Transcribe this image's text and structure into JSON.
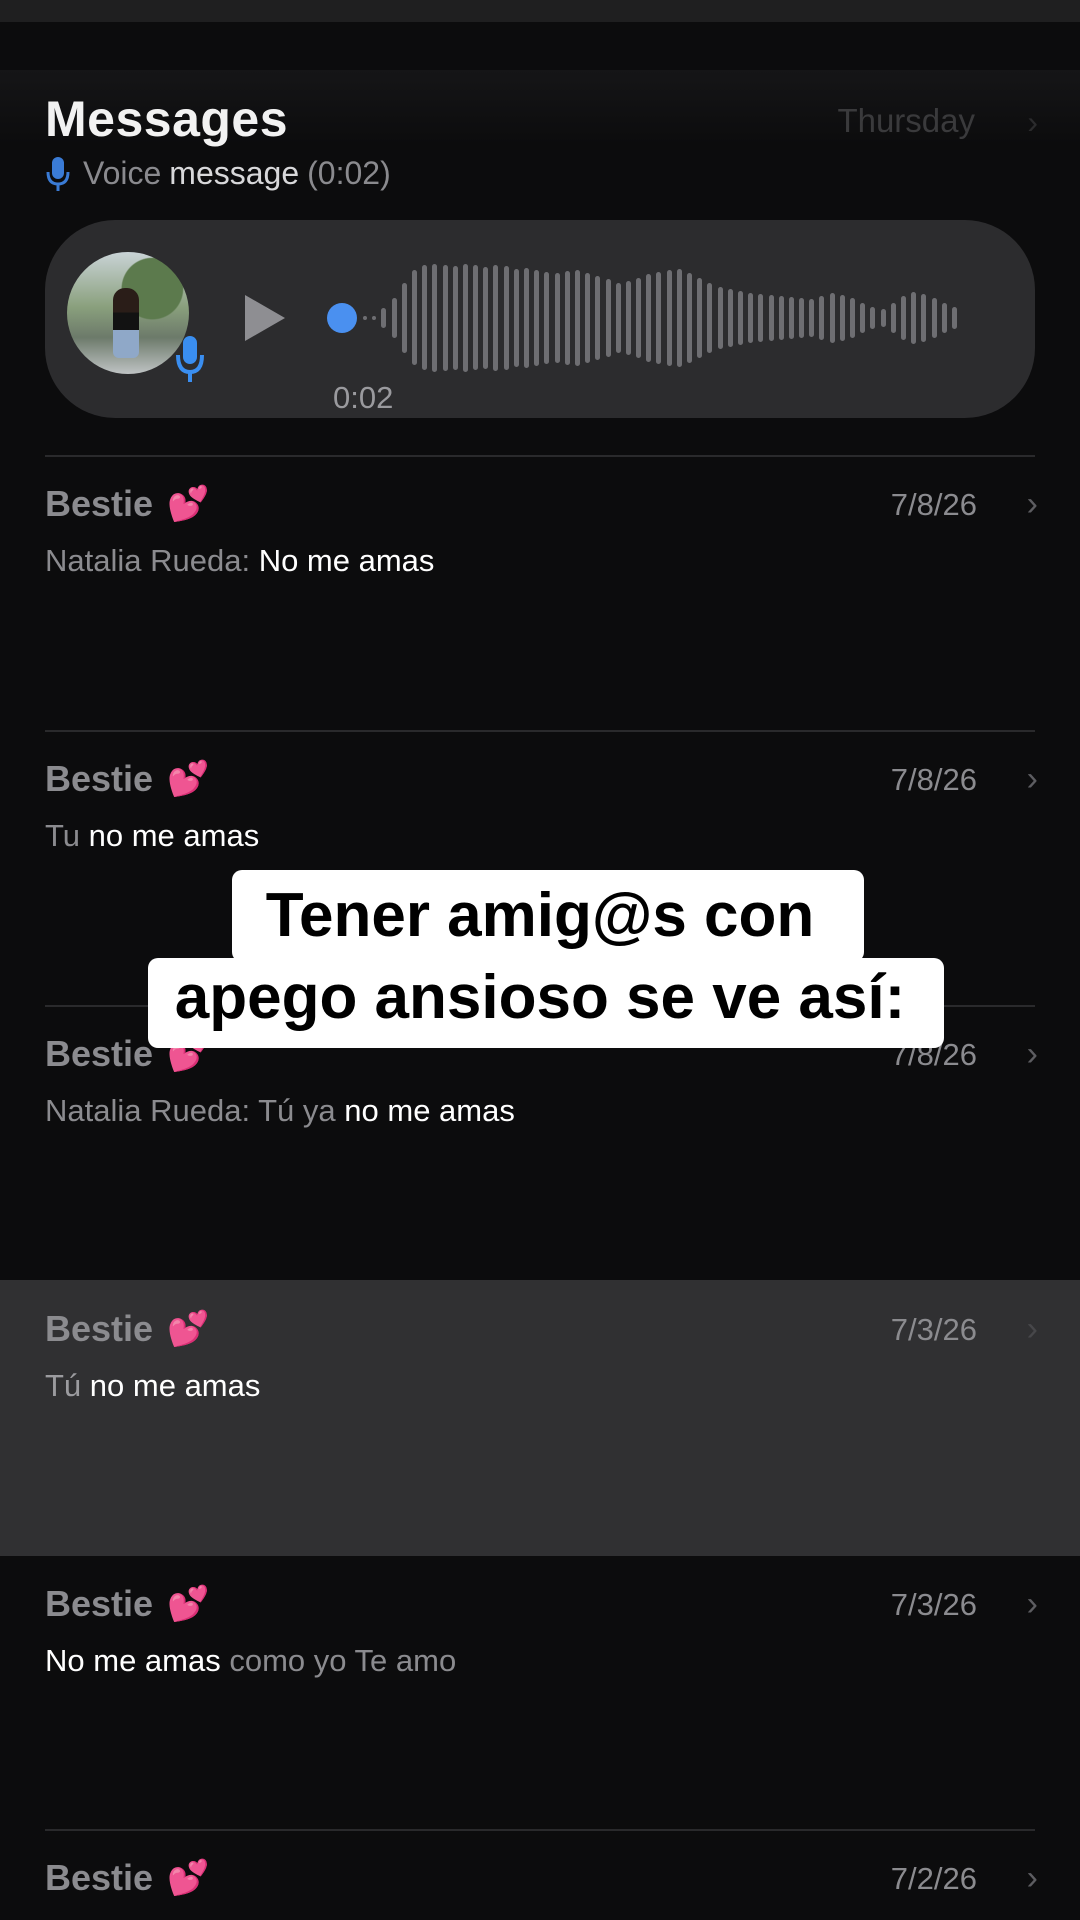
{
  "header": {
    "title": "Messages",
    "date": "Thursday",
    "preview": {
      "icon": "microphone-icon",
      "part1": "Voice",
      "part2": "message",
      "part3": "(0:02)"
    }
  },
  "voice_message": {
    "duration": "0:02",
    "icon_play": "play-icon",
    "icon_mic": "microphone-icon",
    "accent_color": "#4a90f0"
  },
  "conversations": [
    {
      "name": "Bestie",
      "emoji": "💕",
      "date": "7/8/26",
      "msg_dim": "Natalia Rueda: ",
      "msg_bright": "No me amas",
      "msg_tail": ""
    },
    {
      "name": "Bestie",
      "emoji": "💕",
      "date": "7/8/26",
      "msg_dim": "Tu ",
      "msg_bright": "no me amas",
      "msg_tail": ""
    },
    {
      "name": "Bestie",
      "emoji": "💕",
      "date": "7/8/26",
      "msg_dim": "Natalia Rueda: Tú ya ",
      "msg_bright": "no me amas",
      "msg_tail": ""
    },
    {
      "name": "Bestie",
      "emoji": "💕",
      "date": "7/3/26",
      "msg_dim": "Tú ",
      "msg_bright": "no me amas",
      "msg_tail": ""
    },
    {
      "name": "Bestie",
      "emoji": "💕",
      "date": "7/3/26",
      "msg_dim": "",
      "msg_bright": "No me amas",
      "msg_tail": " como yo Te amo"
    },
    {
      "name": "Bestie",
      "emoji": "💕",
      "date": "7/2/26",
      "msg_dim": "",
      "msg_bright": "",
      "msg_tail": ""
    }
  ],
  "caption": {
    "line1": "Tener amig@s con",
    "line2": "apego ansioso se ve así:"
  },
  "chevron_glyph": "›"
}
